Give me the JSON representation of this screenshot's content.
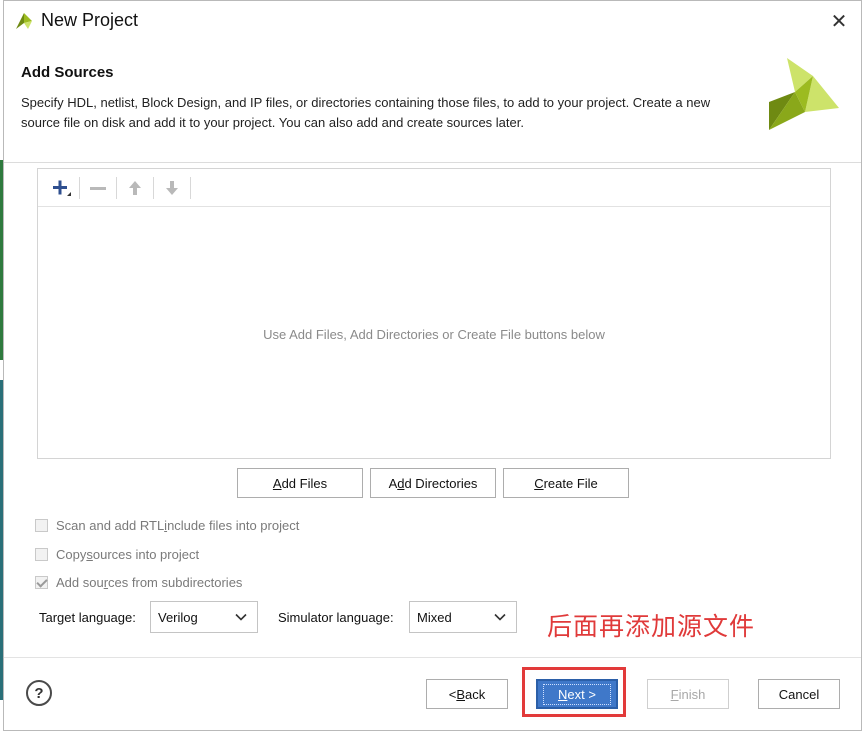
{
  "window": {
    "title": "New Project",
    "close_glyph": "✕"
  },
  "header": {
    "title": "Add Sources",
    "description": "Specify HDL, netlist, Block Design, and IP files, or directories containing those files, to add to your project. Create a new source file on disk and add it to your project. You can also add and create sources later."
  },
  "toolbar": {
    "icons": [
      "plus-icon",
      "minus-icon",
      "arrow-up-icon",
      "arrow-down-icon"
    ]
  },
  "sources": {
    "empty_message": "Use Add Files, Add Directories or Create File buttons below"
  },
  "buttons": {
    "add_files": {
      "pre": "",
      "ul": "A",
      "post": "dd Files"
    },
    "add_directories": {
      "pre": "A",
      "ul": "d",
      "post": "d Directories"
    },
    "create_file": {
      "pre": "",
      "ul": "C",
      "post": "reate File"
    }
  },
  "options": {
    "scan_rtl": {
      "pre": "Scan and add RTL ",
      "ul": "i",
      "post": "nclude files into project",
      "checked": false
    },
    "copy_sources": {
      "pre": "Copy ",
      "ul": "s",
      "post": "ources into project",
      "checked": false
    },
    "add_subdirs": {
      "pre": "Add sou",
      "ul": "r",
      "post": "ces from subdirectories",
      "checked": true
    }
  },
  "language": {
    "target_label": "Target language:",
    "target_value": "Verilog",
    "simulator_label": "Simulator language:",
    "simulator_value": "Mixed"
  },
  "annotation": {
    "text": "后面再添加源文件",
    "color": "#e03a3a"
  },
  "footer": {
    "help": "?",
    "back": {
      "pre": "< ",
      "ul": "B",
      "post": "ack"
    },
    "next": {
      "pre": "",
      "ul": "N",
      "post": "ext >"
    },
    "finish": {
      "pre": "",
      "ul": "F",
      "post": "inish"
    },
    "cancel": "Cancel"
  },
  "colors": {
    "accent": "#3f78c9",
    "logo_green": "#9cbb20",
    "logo_dark": "#6f8a12",
    "logo_light": "#cde36a"
  }
}
